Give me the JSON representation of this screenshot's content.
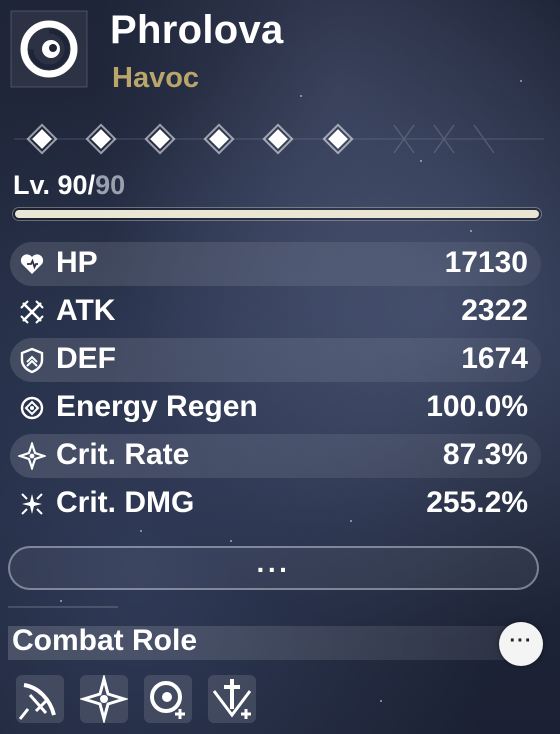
{
  "character": {
    "name": "Phrolova",
    "element": "Havoc",
    "element_icon": "havoc-swirl-icon"
  },
  "sequence": {
    "nodes": 6,
    "unlocked": 6,
    "node_icon": "diamond-icon"
  },
  "level": {
    "prefix": "Lv. ",
    "current": "90",
    "separator": "/",
    "max": "90",
    "progress": 1.0
  },
  "stats": [
    {
      "icon": "heart-icon",
      "label": "HP",
      "value": "17130"
    },
    {
      "icon": "crossed-swords-icon",
      "label": "ATK",
      "value": "2322"
    },
    {
      "icon": "shield-icon",
      "label": "DEF",
      "value": "1674"
    },
    {
      "icon": "energy-regen-icon",
      "label": "Energy Regen",
      "value": "100.0%"
    },
    {
      "icon": "sparkle-icon",
      "label": "Crit. Rate",
      "value": "87.3%"
    },
    {
      "icon": "multi-sparkle-icon",
      "label": "Crit. DMG",
      "value": "255.2%"
    }
  ],
  "more_button": {
    "label": "···"
  },
  "combat_role": {
    "title": "Combat Role",
    "more_label": "···",
    "roles": [
      {
        "icon": "slash-blade-icon"
      },
      {
        "icon": "star-burst-icon"
      },
      {
        "icon": "havoc-plus-icon"
      },
      {
        "icon": "sword-plus-icon"
      }
    ]
  },
  "colors": {
    "element": "#b9a66a",
    "text": "#ffffff",
    "muted": "#9aa0ae",
    "bar_fill": "#eae6d4"
  }
}
